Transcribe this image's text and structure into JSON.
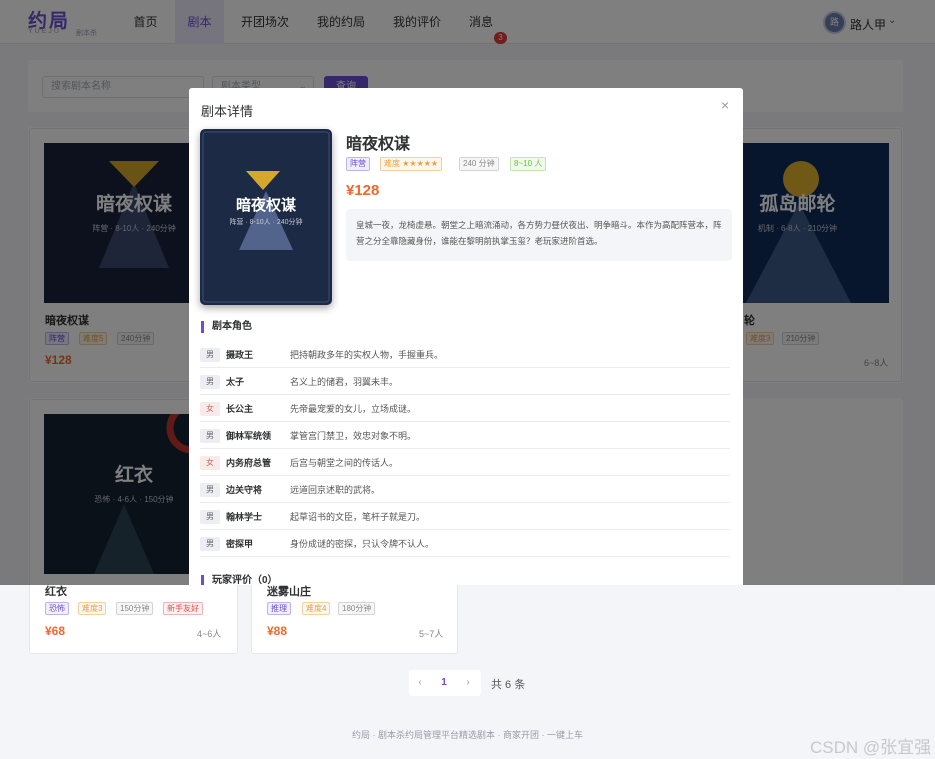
{
  "header": {
    "logo": "约局",
    "logo_sub": "YUEJU",
    "logo_sub2": "剧本杀",
    "nav": [
      "首页",
      "剧本",
      "开团场次",
      "我的约局",
      "我的评价",
      "消息"
    ],
    "message_badge": "3",
    "avatar_text": "路",
    "username": "路人甲",
    "user_chevron": "⌄"
  },
  "filter": {
    "search_placeholder": "搜索剧本名称",
    "type_placeholder": "剧本类型",
    "type_chevron": "⌄",
    "query_label": "查询"
  },
  "cards": [
    {
      "title": "暗夜权谋",
      "cover_title": "暗夜权谋",
      "cover_sub": "阵营 · 8-10人 · 240分钟",
      "tags": [
        "阵营",
        "难度5",
        "240分钟"
      ],
      "price": "¥128",
      "players": ""
    },
    {
      "title": "轮",
      "cover_title": "孤岛邮轮",
      "cover_sub": "机制 · 6-8人 · 210分钟",
      "tags": [
        "难度3",
        "210分钟"
      ],
      "price": "",
      "players": "6~8人"
    },
    {
      "title": "红衣",
      "cover_title": "红衣",
      "cover_sub": "恐怖 · 4-6人 · 150分钟",
      "tags": [
        "恐怖",
        "难度3",
        "150分钟",
        "新手友好"
      ],
      "price": "¥68",
      "players": "4~6人"
    },
    {
      "title": "迷雾山庄",
      "tags": [
        "推理",
        "难度4",
        "180分钟"
      ],
      "price": "¥88",
      "players": "5~7人"
    }
  ],
  "pagination": {
    "prev": "‹",
    "current": "1",
    "next": "›",
    "total": "共 6 条"
  },
  "footer": "约局 · 剧本杀约局管理平台精选剧本 · 商家开团 · 一键上车",
  "watermark": "CSDN @张宜强",
  "modal": {
    "title": "剧本详情",
    "close": "×",
    "cover_title": "暗夜权谋",
    "cover_sub": "阵营 · 8-10人 · 240分钟",
    "name": "暗夜权谋",
    "tags": [
      "阵营",
      "难度 ★★★★★",
      "240 分钟",
      "8~10 人"
    ],
    "price": "¥128",
    "description": "皇城一夜，龙椅虚悬。朝堂之上暗流涌动，各方势力昼伏夜出、明争暗斗。本作为高配阵营本，阵营之分全靠隐藏身份，谁能在黎明前执掌玉玺？老玩家进阶首选。",
    "roles_title": "剧本角色",
    "roles": [
      {
        "sex": "男",
        "name": "摄政王",
        "desc": "把持朝政多年的实权人物，手握重兵。"
      },
      {
        "sex": "男",
        "name": "太子",
        "desc": "名义上的储君，羽翼未丰。"
      },
      {
        "sex": "女",
        "name": "长公主",
        "desc": "先帝最宠爱的女儿，立场成谜。"
      },
      {
        "sex": "男",
        "name": "御林军统领",
        "desc": "掌管宫门禁卫，效忠对象不明。"
      },
      {
        "sex": "女",
        "name": "内务府总管",
        "desc": "后宫与朝堂之间的传话人。"
      },
      {
        "sex": "男",
        "name": "边关守将",
        "desc": "远道回京述职的武将。"
      },
      {
        "sex": "男",
        "name": "翰林学士",
        "desc": "起草诏书的文臣，笔杆子就是刀。"
      },
      {
        "sex": "男",
        "name": "密探甲",
        "desc": "身份成谜的密探，只认令牌不认人。"
      }
    ],
    "reviews_title": "玩家评价（0）"
  },
  "colors": {
    "accent": "#6a4fd3",
    "price": "#f0672c",
    "badge": "#e23b3b"
  }
}
